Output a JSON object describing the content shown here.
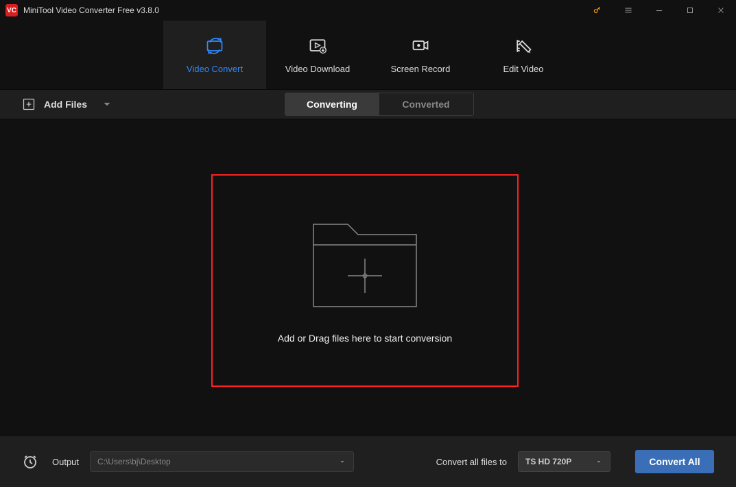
{
  "app": {
    "title": "MiniTool Video Converter Free v3.8.0",
    "logo_text": "VC"
  },
  "nav": {
    "items": [
      {
        "label": "Video Convert",
        "icon": "convert"
      },
      {
        "label": "Video Download",
        "icon": "download"
      },
      {
        "label": "Screen Record",
        "icon": "record"
      },
      {
        "label": "Edit Video",
        "icon": "edit"
      }
    ]
  },
  "toolbar": {
    "add_files_label": "Add Files",
    "sub_tabs": [
      {
        "label": "Converting"
      },
      {
        "label": "Converted"
      }
    ]
  },
  "drop_zone": {
    "text": "Add or Drag files here to start conversion"
  },
  "bottom": {
    "output_label": "Output",
    "output_path": "C:\\Users\\bj\\Desktop",
    "convert_label": "Convert all files to",
    "format": "TS HD 720P",
    "convert_all": "Convert All"
  },
  "colors": {
    "accent_blue": "#2e89ff",
    "highlight_red": "#ff2020",
    "button_blue": "#3a6fb8",
    "key_gold": "#f0a020"
  }
}
